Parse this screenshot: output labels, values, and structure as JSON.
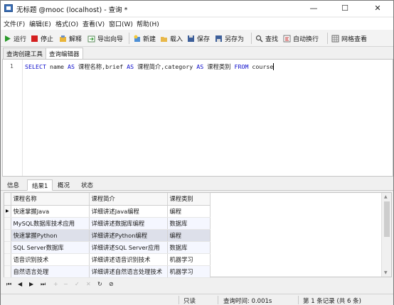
{
  "window": {
    "title": "无标题 @mooc (localhost) - 查询 *",
    "controls": {
      "minimize": "—",
      "maximize": "☐",
      "close": "✕"
    }
  },
  "menu": [
    "文件(F)",
    "编辑(E)",
    "格式(O)",
    "查看(V)",
    "窗口(W)",
    "帮助(H)"
  ],
  "toolbar": {
    "run": "运行",
    "stop": "停止",
    "explain": "解释",
    "export_wizard": "导出向导",
    "new": "新建",
    "load": "载入",
    "save": "保存",
    "save_as": "另存为",
    "find": "查找",
    "word_wrap": "自动换行",
    "grid_view": "网格查看"
  },
  "editor_tabs": [
    "查询创建工具",
    "查询编辑器"
  ],
  "editor": {
    "line_number": "1",
    "tokens": [
      {
        "t": "SELECT",
        "kw": true
      },
      {
        "t": " name "
      },
      {
        "t": "AS",
        "kw": true
      },
      {
        "t": " 课程名称,brief "
      },
      {
        "t": "AS",
        "kw": true
      },
      {
        "t": " 课程简介,category "
      },
      {
        "t": "AS",
        "kw": true
      },
      {
        "t": " 课程类别 "
      },
      {
        "t": "FROM",
        "kw": true
      },
      {
        "t": " course"
      }
    ]
  },
  "result_tabs": [
    "信息",
    "结果1",
    "概况",
    "状态"
  ],
  "result_grid": {
    "columns": [
      "课程名称",
      "课程简介",
      "课程类别"
    ],
    "rows": [
      [
        "快速掌握Java",
        "详细讲述Java编程",
        "编程"
      ],
      [
        "MySQL数据库技术应用",
        "详细讲述数据库编程",
        "数据库"
      ],
      [
        "快速掌握Python",
        "详细讲述Python编程",
        "编程"
      ],
      [
        "SQL Server数据库",
        "详细讲述SQL Server应用",
        "数据库"
      ],
      [
        "语音识别技术",
        "详细讲述语音识别技术",
        "机器学习"
      ],
      [
        "自然语言处理",
        "详细讲述自然语言处理技术",
        "机器学习"
      ]
    ],
    "current_row_marker": "▶"
  },
  "nav_buttons": [
    "⏮",
    "◀",
    "▶",
    "⏭",
    "+",
    "−",
    "✓",
    "✕",
    "↻",
    "⊘"
  ],
  "status": {
    "mode": "只读",
    "query_time": "查询时间: 0.001s",
    "record": "第 1 条记录 (共 6 条)"
  },
  "colors": {
    "keyword": "#1010cc",
    "stop_icon": "#d42020",
    "run_icon": "#2a9a2a"
  }
}
